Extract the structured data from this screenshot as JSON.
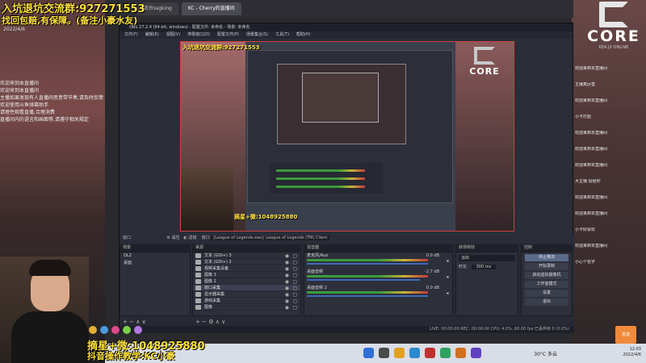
{
  "overlay": {
    "title_line1": "入坑退坑交流群:927271553",
    "title_line2": "找回包赔,有保障。(备注小豪水友)",
    "bottom_line1": "摘星+微:1048925880",
    "bottom_line2": "抖音操作教学:KC小豪"
  },
  "browser_tabs": [
    "后台ssgking",
    "KC - Cherry的直播间"
  ],
  "obs": {
    "window_title": "OBS 27.2.4 (64-bit, windows) - 配置文件: 未命名 - 场景: 未命名",
    "menu": [
      "文件(F)",
      "编辑(E)",
      "视图(V)",
      "停靠窗口(D)",
      "配置文件(P)",
      "场景集合(S)",
      "工具(T)",
      "帮助(H)"
    ],
    "preview_text1": "入坑退坑交流群:927271553",
    "preview_text2": "摘星+微:1048925880",
    "logo_word": "CORE",
    "context_bar": {
      "source_label": "窗口",
      "properties": "属性",
      "filters": "滤镜",
      "window_value": "[League of Legends.exe]: League of Legends (TM) Client"
    },
    "scenes": {
      "title": "场景",
      "items": [
        "OL2",
        "桌面"
      ]
    },
    "sources": {
      "title": "来源",
      "items": [
        {
          "name": "文本 (GDI+) 3"
        },
        {
          "name": "文本 (GDI+) 2"
        },
        {
          "name": "视频采集设备"
        },
        {
          "name": "图像 3"
        },
        {
          "name": "图像 2"
        },
        {
          "name": "窗口采集"
        },
        {
          "name": "显示器采集"
        },
        {
          "name": "游戏采集"
        },
        {
          "name": "图像"
        }
      ]
    },
    "mixer": {
      "title": "混音器",
      "channels": [
        {
          "name": "麦克风/Aux",
          "db": "0.0 dB"
        },
        {
          "name": "桌面音频",
          "db": "-2.7 dB"
        },
        {
          "name": "桌面音频 2",
          "db": "0.0 dB"
        }
      ]
    },
    "transitions": {
      "title": "转场特效",
      "type": "淡出",
      "duration_label": "时长",
      "duration": "300 ms"
    },
    "controls": {
      "title": "控制",
      "buttons": [
        "停止推流",
        "开始录制",
        "启动虚拟摄像机",
        "工作室模式",
        "设置",
        "退出"
      ]
    },
    "status": "LIVE: 00:00:00  REC: 00:00:00  CPU: 4.0%, 60.00 fps  已丢弃帧 0 (0.0%)"
  },
  "left_chat": [
    "欢迎来到本直播间",
    "欢迎来到本直播间",
    "主播如果发现有人直播间恶意带节奏,请及时反馈",
    "欢迎使用斗鱼弹幕助手",
    "请理性观看直播,合理消费",
    "直播间内的语言和画面等,请遵守相关规定"
  ],
  "left_date": "2022/4/6",
  "right_chat": [
    "欢迎来到本直播间",
    "主播真厉害",
    "欢迎来到本直播间",
    "小卡打脸",
    "欢迎来到本直播间",
    "欢迎来到本直播间",
    "欢迎来到本直播间",
    "大主播 投给你",
    "欢迎来到本直播间",
    "欢迎来到本直播间",
    "小卡好会玩",
    "欢迎来到本直播间",
    "小心个名字"
  ],
  "right_logo": {
    "word": "CORE",
    "sub": "KEA JX ONLINE"
  },
  "send_label": "发送",
  "taskbar": {
    "temperature": "30°C 多云",
    "time": "12:03",
    "date": "2022/4/6"
  },
  "colors": {
    "overlay_text": "#ffe23a",
    "obs_bg": "#2b2e38",
    "preview_border": "#d24040",
    "send_button": "#f08a3a"
  }
}
